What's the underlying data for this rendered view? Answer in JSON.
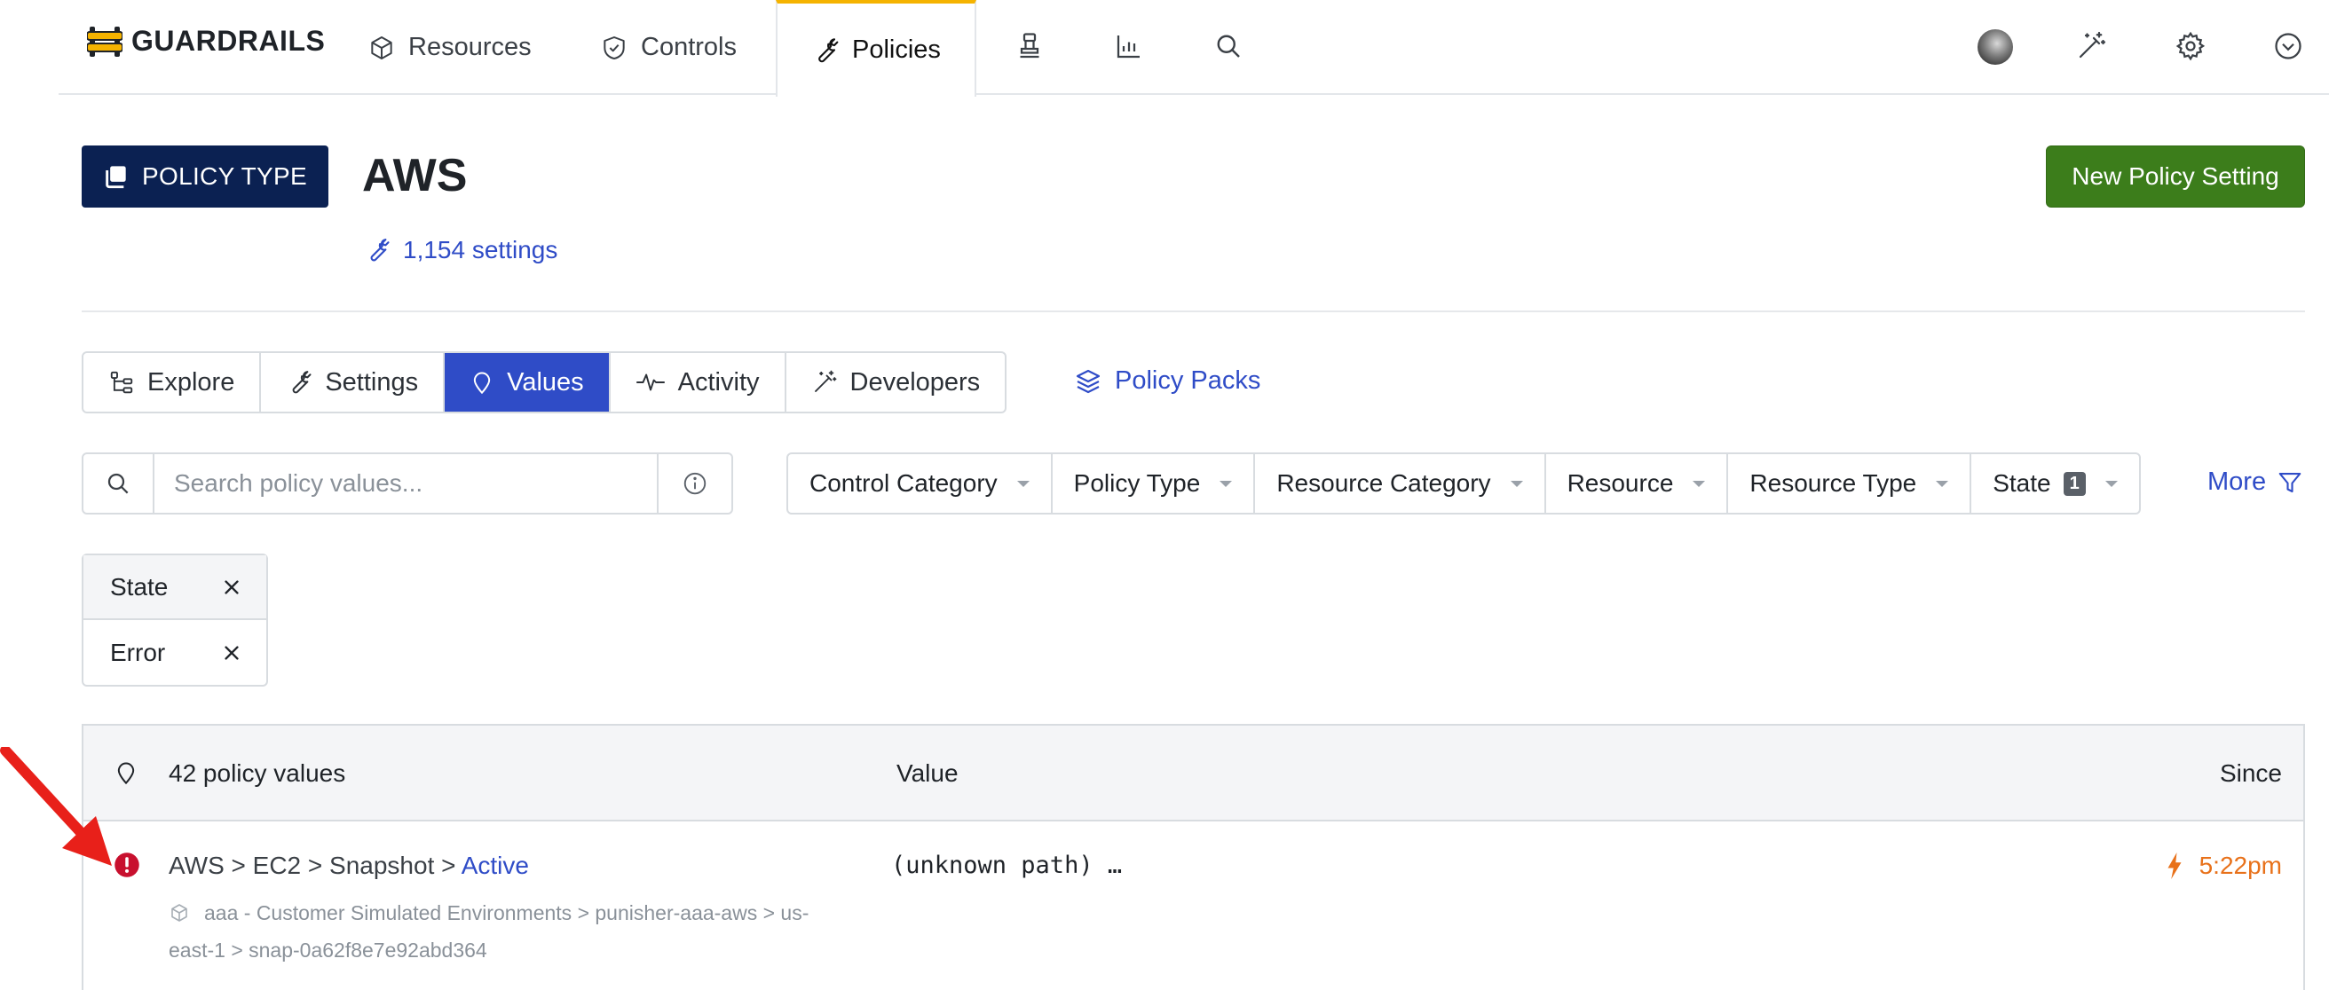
{
  "app": {
    "brand": "GUARDRAILS"
  },
  "nav": {
    "items": [
      {
        "label": "Resources",
        "icon": "cube-icon"
      },
      {
        "label": "Controls",
        "icon": "shield-check-icon"
      },
      {
        "label": "Policies",
        "icon": "wrench-icon",
        "active": true
      }
    ],
    "icon_buttons": [
      "benchmark-icon",
      "reports-icon",
      "search-icon"
    ],
    "right_icons": [
      "avatar",
      "magic-wand-icon",
      "gear-icon",
      "chevron-down-circle-icon"
    ]
  },
  "header": {
    "type_badge": "POLICY TYPE",
    "title": "AWS",
    "settings_link": "1,154 settings",
    "primary_button": "New Policy Setting"
  },
  "tabs": [
    {
      "label": "Explore",
      "icon": "hierarchy-icon"
    },
    {
      "label": "Settings",
      "icon": "wrench-icon"
    },
    {
      "label": "Values",
      "icon": "map-pin-icon",
      "active": true
    },
    {
      "label": "Activity",
      "icon": "pulse-icon"
    },
    {
      "label": "Developers",
      "icon": "magic-wand-icon"
    }
  ],
  "policy_packs": "Policy Packs",
  "search": {
    "placeholder": "Search policy values...",
    "value": ""
  },
  "filters": [
    {
      "label": "Control Category"
    },
    {
      "label": "Policy Type"
    },
    {
      "label": "Resource Category"
    },
    {
      "label": "Resource"
    },
    {
      "label": "Resource Type"
    },
    {
      "label": "State",
      "count": "1"
    }
  ],
  "more": "More",
  "active_filter": {
    "key": "State",
    "value": "Error"
  },
  "results": {
    "count_label": "42 policy values",
    "columns": {
      "value": "Value",
      "since": "Since"
    },
    "rows": [
      {
        "status": "error",
        "path": "AWS > EC2 > Snapshot > ",
        "state": "Active",
        "resource_line1": "aaa - Customer Simulated Environments > punisher-aaa-aws > us-",
        "resource_line2": "east-1 > snap-0a62f8e7e92abd364",
        "value": "(unknown path) …",
        "since": "5:22pm"
      }
    ]
  },
  "colors": {
    "accent": "#2f4cc7",
    "primary_button": "#3c7d1b",
    "badge_navy": "#0b2152",
    "active_tab_border": "#f5b300",
    "error": "#c8102e",
    "since": "#e8711a",
    "annotation_arrow": "#e8201a"
  }
}
